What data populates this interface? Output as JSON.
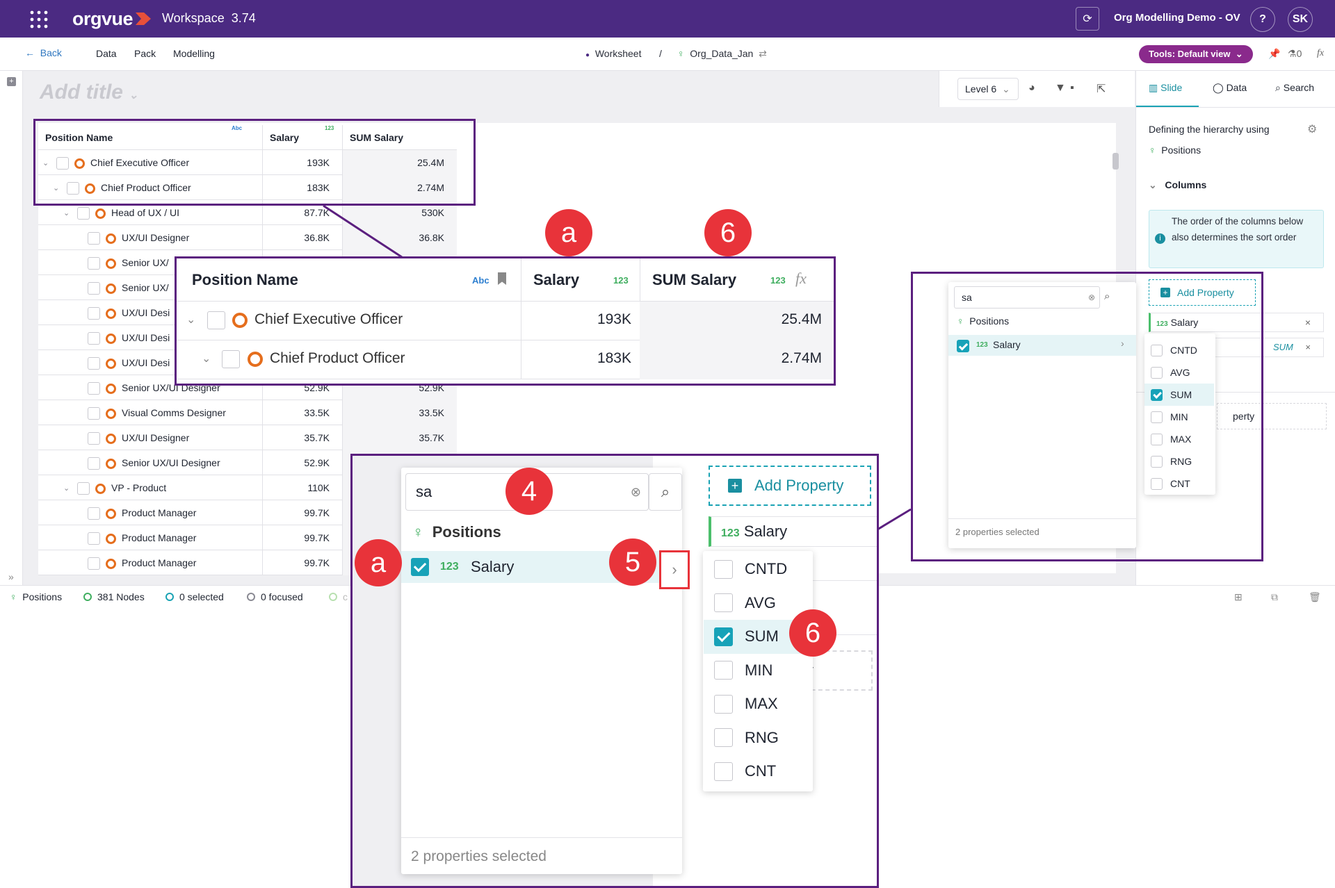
{
  "topbar": {
    "logo": "orgvue",
    "workspace": "Workspace",
    "version": "3.74",
    "org_name": "Org Modelling Demo - OV",
    "help": "?",
    "avatar": "SK"
  },
  "navbar": {
    "back": "Back",
    "menu": [
      "Data",
      "Pack",
      "Modelling"
    ],
    "breadcrumb_worksheet": "Worksheet",
    "breadcrumb_sep": "/",
    "breadcrumb_dataset": "Org_Data_Jan",
    "tools": "Tools: Default view",
    "flask_count": "0",
    "fx": "fx"
  },
  "canvas": {
    "title_placeholder": "Add title",
    "level": "Level 6"
  },
  "table": {
    "headers": {
      "name": "Position Name",
      "name_tag": "Abc",
      "salary": "Salary",
      "salary_tag": "123",
      "sum": "SUM Salary",
      "sum_tag": "123",
      "fx": "fx"
    },
    "rows": [
      {
        "name": "Chief Executive Officer",
        "salary": "193K",
        "sum": "25.4M"
      },
      {
        "name": "Chief Product Officer",
        "salary": "183K",
        "sum": "2.74M"
      },
      {
        "name": "Head of UX / UI",
        "salary": "87.7K",
        "sum": "530K"
      },
      {
        "name": "UX/UI Designer",
        "salary": "36.8K",
        "sum": "36.8K"
      },
      {
        "name": "Senior UX/",
        "salary": "",
        "sum": ""
      },
      {
        "name": "Senior UX/",
        "salary": "",
        "sum": ""
      },
      {
        "name": "UX/UI Desi",
        "salary": "",
        "sum": ""
      },
      {
        "name": "UX/UI Desi",
        "salary": "",
        "sum": ""
      },
      {
        "name": "UX/UI Desi",
        "salary": "",
        "sum": ""
      },
      {
        "name": "Senior UX/UI Designer",
        "salary": "52.9K",
        "sum": "52.9K"
      },
      {
        "name": "Visual Comms Designer",
        "salary": "33.5K",
        "sum": "33.5K"
      },
      {
        "name": "UX/UI Designer",
        "salary": "35.7K",
        "sum": "35.7K"
      },
      {
        "name": "Senior UX/UI Designer",
        "salary": "52.9K",
        "sum": ""
      },
      {
        "name": "VP - Product",
        "salary": "110K",
        "sum": ""
      },
      {
        "name": "Product Manager",
        "salary": "99.7K",
        "sum": ""
      },
      {
        "name": "Product Manager",
        "salary": "99.7K",
        "sum": ""
      },
      {
        "name": "Product Manager",
        "salary": "99.7K",
        "sum": ""
      }
    ]
  },
  "status": {
    "positions": "Positions",
    "nodes": "381 Nodes",
    "selected": "0 selected",
    "focused": "0 focused",
    "partial": "c"
  },
  "rpanel": {
    "tabs": [
      "Slide",
      "Data",
      "Search"
    ],
    "hierarchy_text": "Defining the hierarchy using",
    "hierarchy_value": "Positions",
    "columns": "Columns",
    "info": "The order of the columns below also determines the sort order",
    "add_property": "Add Property",
    "salary_tag": "123",
    "salary": "Salary",
    "sum_tag": "SUM",
    "remove": "×",
    "perty": "perty"
  },
  "popup": {
    "search_value": "sa",
    "group": "Positions",
    "item_tag": "123",
    "item": "Salary",
    "footer": "2 properties selected",
    "aggs": [
      {
        "label": "CNTD",
        "checked": false
      },
      {
        "label": "AVG",
        "checked": false
      },
      {
        "label": "SUM",
        "checked": true
      },
      {
        "label": "MIN",
        "checked": false
      },
      {
        "label": "MAX",
        "checked": false
      },
      {
        "label": "RNG",
        "checked": false
      },
      {
        "label": "CNT",
        "checked": false
      }
    ]
  },
  "badges": {
    "a": "a",
    "six": "6",
    "four": "4",
    "five": "5"
  },
  "colors": {
    "brand": "#4b2a82",
    "callout": "#5b1f7f",
    "badge": "#e8333a",
    "accent": "#17a2b8",
    "node": "#e56e1d",
    "tools": "#8a2a8c"
  }
}
